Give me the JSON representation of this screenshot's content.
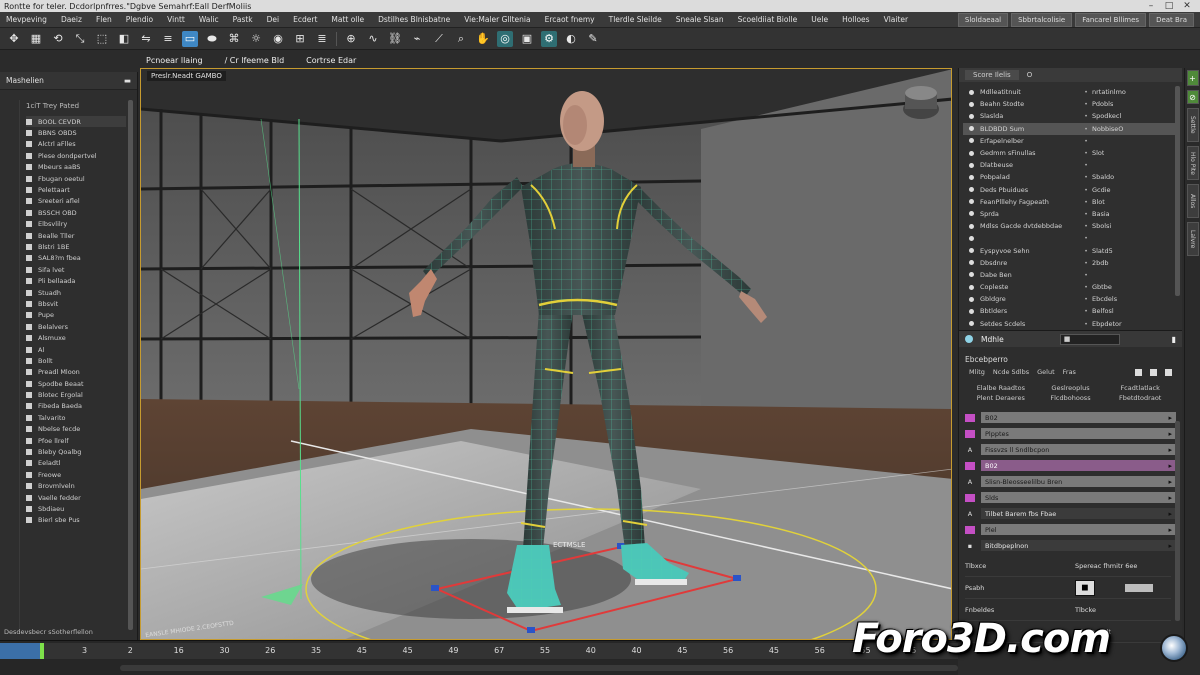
{
  "window": {
    "title": "Rontte for teler. Dcdorlpnfrres.\"Dgbve Semahrf:Eall DerfMoliis"
  },
  "menu": {
    "items": [
      "Mevpeving",
      "Daeiz",
      "Flen",
      "Plendio",
      "Vintt",
      "Walic",
      "Pastk",
      "Dei",
      "Ecdert",
      "Matt olle",
      "Dstilhes Blnisbatne",
      "Vie:Maler Glltenia",
      "Ercaot fnemy",
      "Tlerdle Sleilde",
      "Sneale Slsan",
      "Scoeldiiat Biolle",
      "Uele",
      "Holloes",
      "Vlaiter"
    ],
    "right_tabs": [
      "Sloldaeaal",
      "Sbbrtalcolisie",
      "Fancarel Bllimes",
      "Deat Bra"
    ]
  },
  "toolbar": {
    "icons": [
      "move-icon",
      "grid-icon",
      "rotate-icon",
      "scale-icon",
      "select-icon",
      "snap-icon",
      "mirror-icon",
      "align-icon",
      "viewport-icon",
      "camera-icon",
      "sculpt-icon",
      "light-icon",
      "material-icon",
      "render-icon",
      "paint-icon",
      "uv-icon",
      "curve-icon",
      "link-icon",
      "unlink-icon",
      "bone-icon",
      "zoom-icon",
      "pan-icon",
      "orbit-icon",
      "frame-icon",
      "settings-icon",
      "display-icon",
      "brush-icon"
    ]
  },
  "left_panel": {
    "title": "Mashelien",
    "subtitle": "1ciT Trey Pated",
    "items": [
      "BOOL CEVDR",
      "BBNS OBDS",
      "Alctrl aFlles",
      "Plese dondpertvel",
      "Mbeurs aaBS",
      "Fbugan oeetul",
      "Pelettaart",
      "Sreeteri aflel",
      "BSSCH OBD",
      "Elbsvlilry",
      "Bealle Tller",
      "Blstri 1BE",
      "SAL8?m fbea",
      "Sifa lvet",
      "Pli bellaada",
      "Stuadh",
      "Bbsvit",
      "Pupe",
      "Belalvers",
      "Alsmuxe",
      "Al",
      "Bollt",
      "Preadl Mloon",
      "Spodbe Beaat",
      "Blotec Ergolal",
      "Fibeda Baeda",
      "Talvarito",
      "Nbelse fecde",
      "Pfoe llrelf",
      "Bleby Qoalbg",
      "Eeladtl",
      "Freowe",
      "Brovmlveln",
      "Vaelle fedder",
      "Sbdiaeu",
      "Bierl sbe Pus"
    ],
    "footer": "Desdevsbecr sSotherflellon"
  },
  "viewport": {
    "label": "Preslr.Neadt GAMBO",
    "tabs": [
      "Pcnoear llaing",
      "/ Cr lfeeme Bld",
      "Cortrse Edar"
    ],
    "corner_text": "EANSLE MHIODE 2.CEOFSTTD",
    "foot_text": "ECTMSLE"
  },
  "right_top": {
    "tabs": [
      "Score Ilelis",
      "O"
    ],
    "rows": [
      {
        "label": "Mdlleatitnuit",
        "mid": "•",
        "value": "nrtatinlmo"
      },
      {
        "label": "Beahn Stodte",
        "mid": "•",
        "value": "Pdobls"
      },
      {
        "label": "Slaslda",
        "mid": "•",
        "value": "Spodkecl"
      },
      {
        "label": "BLDBDD Sum",
        "mid": "•",
        "value": "NobbiseO"
      },
      {
        "label": "Erfapelnelber",
        "mid": "•",
        "value": ""
      },
      {
        "label": "Gedmm sFinullas",
        "mid": "•",
        "value": "Slot"
      },
      {
        "label": "Dlatbeuse",
        "mid": "•",
        "value": ""
      },
      {
        "label": "Pobpalad",
        "mid": "•",
        "value": "Sbaldo"
      },
      {
        "label": "Deds Pbuidues",
        "mid": "•",
        "value": "Gcdie"
      },
      {
        "label": "FeanPlllehy Fagpeath",
        "mid": "•",
        "value": "Blot"
      },
      {
        "label": "Sprda",
        "mid": "•",
        "value": "Basia"
      },
      {
        "label": "Mdlss Gacde dvtdebbdae",
        "mid": "•",
        "value": "Sbolsi"
      },
      {
        "label": "",
        "mid": "•",
        "value": ""
      },
      {
        "label": "Eyspyvoe Sehn",
        "mid": "•",
        "value": "Slatd5"
      },
      {
        "label": "Dbsdnre",
        "mid": "•",
        "value": "2bdb"
      },
      {
        "label": "Dabe Ben",
        "mid": "•",
        "value": ""
      },
      {
        "label": "Copleste",
        "mid": "•",
        "value": "Gbtbe"
      },
      {
        "label": "Gbldgre",
        "mid": "•",
        "value": "Ebcdels"
      },
      {
        "label": "Bbtlders",
        "mid": "•",
        "value": "Belfosl"
      },
      {
        "label": "Setdes Scdels",
        "mid": "•",
        "value": "Ebpdetor"
      }
    ]
  },
  "modifier": {
    "title": "Mdhle",
    "box_text": "■",
    "section": "Ebcebperro",
    "tool_labels": [
      "Mlitg",
      "Ncde Sdlbs",
      "Gelut",
      "Fras"
    ],
    "buttons": [
      "Elalbe Raadtos",
      "Geslreoplus",
      "Fcadtlatlack",
      "Plent Deraeres",
      "Flcdbohooss",
      "Fbetdtodraot"
    ],
    "stack": [
      {
        "marker": "tag",
        "label": "B02",
        "style": "bar"
      },
      {
        "marker": "tag",
        "label": "Plpptes",
        "style": "bar"
      },
      {
        "marker": "A",
        "label": "Fissvzs ll Sndlbcpon",
        "style": "bar"
      },
      {
        "marker": "tag",
        "label": "B02",
        "style": "pink"
      },
      {
        "marker": "A",
        "label": "Slisn-Bleosseelilbu Bren",
        "style": "bar"
      },
      {
        "marker": "tag",
        "label": "Slds",
        "style": "bar"
      },
      {
        "marker": "A",
        "label": "Tilbet Barem fbs Fbae",
        "style": "dark"
      },
      {
        "marker": "tag",
        "label": "Plel",
        "style": "bar"
      },
      {
        "marker": "▪",
        "label": "Bitdbpeplnon",
        "style": "dark"
      }
    ],
    "props": [
      {
        "label": "Tlbxce",
        "extra": "Spereac fhmitr 6ee"
      },
      {
        "label": "Psabh",
        "extra": ""
      },
      {
        "label": "Fnbeldes",
        "extra": "Tlbcke"
      },
      {
        "label": "",
        "extra": "Fdonnseplt"
      }
    ]
  },
  "side_strip": {
    "buttons": [
      "+",
      "⊘",
      "Settle",
      "Hlo Pite",
      "Allos",
      "Lalvre"
    ]
  },
  "timeline": {
    "frames": [
      "3",
      "2",
      "16",
      "30",
      "26",
      "35",
      "45",
      "45",
      "49",
      "67",
      "55",
      "40",
      "40",
      "45",
      "56",
      "45",
      "56",
      "55",
      "55"
    ]
  },
  "watermark": {
    "text": "Foro3D.com"
  }
}
